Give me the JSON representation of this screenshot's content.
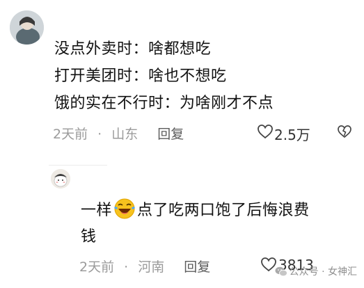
{
  "comment1": {
    "lines": [
      "没点外卖时：啥都想吃",
      "打开美团时：啥也不想吃",
      "饿的实在不行时：为啥刚才不点"
    ],
    "time": "2天前",
    "sep": "·",
    "location": "山东",
    "reply": "回复",
    "likes": "2.5万"
  },
  "comment2": {
    "text_before": "一样",
    "emoji": "laughing-tears-emoji",
    "text_after": "点了吃两口饱了后悔浪费",
    "line2": "钱",
    "time": "2天前",
    "sep": "·",
    "location": "河南",
    "reply": "回复",
    "likes": "3813"
  },
  "watermark": "公众号 · 女神汇",
  "icons": [
    "heart-icon",
    "dislike-heart-icon",
    "wechat-icon",
    "avatar"
  ],
  "colors": {
    "text": "#111111",
    "meta": "#9b9b9b",
    "reply": "#5c5c5c"
  }
}
